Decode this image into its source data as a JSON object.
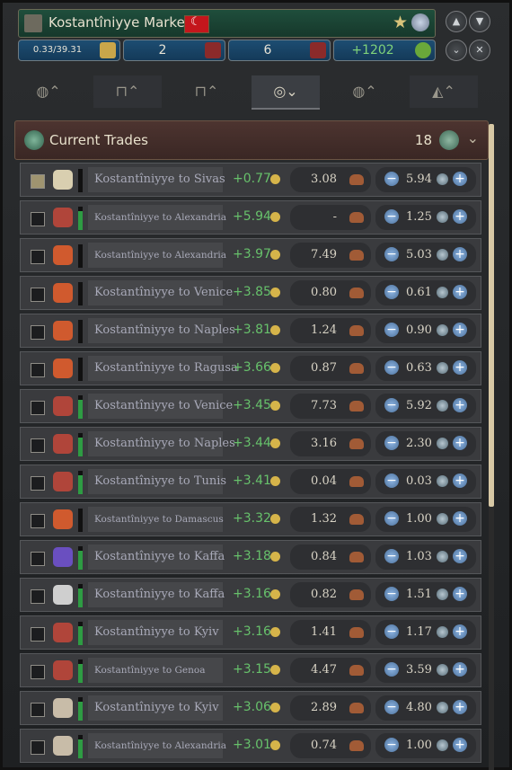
{
  "window": {
    "title": "Kostantîniyye Market",
    "stats": [
      "0.33/39.31",
      "2",
      "6",
      "+1202"
    ]
  },
  "tabs": [
    "tab-overview",
    "tab-buildings",
    "tab-production",
    "tab-trades",
    "tab-routes",
    "tab-pops"
  ],
  "section": {
    "title": "Current Trades",
    "count": "18"
  },
  "colors": {
    "profit": "#67c16b",
    "accent_blue": "#1d4d72",
    "header": "#4d3430"
  },
  "trades": [
    {
      "route": "Kostantîniyye to Sivas",
      "profit": "+0.77",
      "cost": "3.08",
      "amount": "5.94",
      "small": false,
      "checked": true,
      "good": "#d9cfb0",
      "bar": 0.0
    },
    {
      "route": "Kostantîniyye to Alexandria",
      "profit": "+5.94",
      "cost": "-",
      "amount": "1.25",
      "small": true,
      "checked": false,
      "good": "#b0453a",
      "bar": 0.8
    },
    {
      "route": "Kostantîniyye to Alexandria",
      "profit": "+3.97",
      "cost": "7.49",
      "amount": "5.03",
      "small": true,
      "checked": false,
      "good": "#d05a2e",
      "bar": 0.0
    },
    {
      "route": "Kostantîniyye to Venice",
      "profit": "+3.85",
      "cost": "0.80",
      "amount": "0.61",
      "small": false,
      "checked": false,
      "good": "#d05a2e",
      "bar": 0.0
    },
    {
      "route": "Kostantîniyye to Naples",
      "profit": "+3.81",
      "cost": "1.24",
      "amount": "0.90",
      "small": false,
      "checked": false,
      "good": "#d05a2e",
      "bar": 0.0
    },
    {
      "route": "Kostantîniyye to Ragusa",
      "profit": "+3.66",
      "cost": "0.87",
      "amount": "0.63",
      "small": false,
      "checked": false,
      "good": "#d05a2e",
      "bar": 0.0
    },
    {
      "route": "Kostantîniyye to Venice",
      "profit": "+3.45",
      "cost": "7.73",
      "amount": "5.92",
      "small": false,
      "checked": false,
      "good": "#b0453a",
      "bar": 0.8
    },
    {
      "route": "Kostantîniyye to Naples",
      "profit": "+3.44",
      "cost": "3.16",
      "amount": "2.30",
      "small": false,
      "checked": false,
      "good": "#b0453a",
      "bar": 0.8
    },
    {
      "route": "Kostantîniyye to Tunis",
      "profit": "+3.41",
      "cost": "0.04",
      "amount": "0.03",
      "small": false,
      "checked": false,
      "good": "#b0453a",
      "bar": 0.8
    },
    {
      "route": "Kostantîniyye to Damascus",
      "profit": "+3.32",
      "cost": "1.32",
      "amount": "1.00",
      "small": true,
      "checked": false,
      "good": "#d05a2e",
      "bar": 0.0
    },
    {
      "route": "Kostantîniyye to Kaffa",
      "profit": "+3.18",
      "cost": "0.84",
      "amount": "1.03",
      "small": false,
      "checked": false,
      "good": "#6a4fc0",
      "bar": 0.8
    },
    {
      "route": "Kostantîniyye to Kaffa",
      "profit": "+3.16",
      "cost": "0.82",
      "amount": "1.51",
      "small": false,
      "checked": false,
      "good": "#cfcfcf",
      "bar": 0.8
    },
    {
      "route": "Kostantîniyye to Kyiv",
      "profit": "+3.16",
      "cost": "1.41",
      "amount": "1.17",
      "small": false,
      "checked": false,
      "good": "#b0453a",
      "bar": 0.8
    },
    {
      "route": "Kostantîniyye to Genoa",
      "profit": "+3.15",
      "cost": "4.47",
      "amount": "3.59",
      "small": true,
      "checked": false,
      "good": "#b0453a",
      "bar": 0.8
    },
    {
      "route": "Kostantîniyye to Kyiv",
      "profit": "+3.06",
      "cost": "2.89",
      "amount": "4.80",
      "small": false,
      "checked": false,
      "good": "#c8bca8",
      "bar": 0.8
    },
    {
      "route": "Kostantîniyye to Alexandria",
      "profit": "+3.01",
      "cost": "0.74",
      "amount": "1.00",
      "small": true,
      "checked": false,
      "good": "#c8bca8",
      "bar": 0.8
    }
  ]
}
